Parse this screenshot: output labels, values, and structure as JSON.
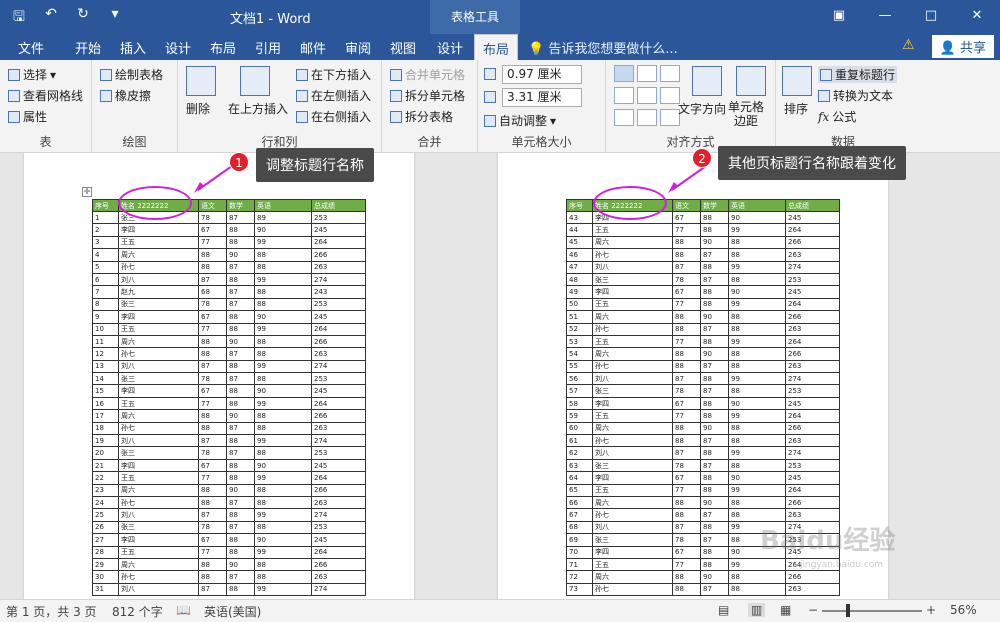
{
  "window": {
    "title": "文档1 - Word",
    "context_tab": "表格工具",
    "quick_access": [
      "save-icon",
      "undo-icon",
      "redo-icon",
      "customize-icon"
    ],
    "window_buttons": [
      "ribbon-display-icon",
      "minimize-icon",
      "maximize-icon",
      "close-icon"
    ]
  },
  "tabs": [
    "文件",
    "开始",
    "插入",
    "设计",
    "布局",
    "引用",
    "邮件",
    "审阅",
    "视图",
    "设计",
    "布局"
  ],
  "active_tab": "布局",
  "tell_me": "告诉我您想要做什么...",
  "share": "共享",
  "ribbon": {
    "table_group": {
      "label": "表",
      "items": [
        "选择",
        "查看网格线",
        "属性"
      ]
    },
    "draw_group": {
      "label": "绘图",
      "items": [
        "绘制表格",
        "橡皮擦"
      ]
    },
    "rowscols_group": {
      "label": "行和列",
      "delete": "删除",
      "insert_above": "在上方插入",
      "items": [
        "在下方插入",
        "在左侧插入",
        "在右侧插入"
      ]
    },
    "merge_group": {
      "label": "合并",
      "items": [
        "合并单元格",
        "拆分单元格",
        "拆分表格"
      ]
    },
    "cellsize_group": {
      "label": "单元格大小",
      "height": "0.97 厘米",
      "width": "3.31 厘米",
      "autofit": "自动调整"
    },
    "align_group": {
      "label": "对齐方式",
      "text_direction": "文字方向",
      "cell_margins": "单元格\n边距"
    },
    "data_group": {
      "label": "数据",
      "sort": "排序",
      "items": [
        "重复标题行",
        "转换为文本",
        "公式"
      ]
    }
  },
  "table_header": [
    "序号",
    "姓名 2222222",
    "语文",
    "数学",
    "英语",
    "总成绩"
  ],
  "page1_rows": [
    [
      "1",
      "张三",
      "78",
      "87",
      "89",
      "253"
    ],
    [
      "2",
      "李四",
      "67",
      "88",
      "90",
      "245"
    ],
    [
      "3",
      "王五",
      "77",
      "88",
      "99",
      "264"
    ],
    [
      "4",
      "周六",
      "88",
      "90",
      "88",
      "266"
    ],
    [
      "5",
      "孙七",
      "88",
      "87",
      "88",
      "263"
    ],
    [
      "6",
      "刘八",
      "87",
      "88",
      "99",
      "274"
    ],
    [
      "7",
      "赵九",
      "68",
      "87",
      "88",
      "243"
    ],
    [
      "8",
      "张三",
      "78",
      "87",
      "88",
      "253"
    ],
    [
      "9",
      "李四",
      "67",
      "88",
      "90",
      "245"
    ],
    [
      "10",
      "王五",
      "77",
      "88",
      "99",
      "264"
    ],
    [
      "11",
      "周六",
      "88",
      "90",
      "88",
      "266"
    ],
    [
      "12",
      "孙七",
      "88",
      "87",
      "88",
      "263"
    ],
    [
      "13",
      "刘八",
      "87",
      "88",
      "99",
      "274"
    ],
    [
      "14",
      "张三",
      "78",
      "87",
      "88",
      "253"
    ],
    [
      "15",
      "李四",
      "67",
      "88",
      "90",
      "245"
    ],
    [
      "16",
      "王五",
      "77",
      "88",
      "99",
      "264"
    ],
    [
      "17",
      "周六",
      "88",
      "90",
      "88",
      "266"
    ],
    [
      "18",
      "孙七",
      "88",
      "87",
      "88",
      "263"
    ],
    [
      "19",
      "刘八",
      "87",
      "88",
      "99",
      "274"
    ],
    [
      "20",
      "张三",
      "78",
      "87",
      "88",
      "253"
    ],
    [
      "21",
      "李四",
      "67",
      "88",
      "90",
      "245"
    ],
    [
      "22",
      "王五",
      "77",
      "88",
      "99",
      "264"
    ],
    [
      "23",
      "周六",
      "88",
      "90",
      "88",
      "266"
    ],
    [
      "24",
      "孙七",
      "88",
      "87",
      "88",
      "263"
    ],
    [
      "25",
      "刘八",
      "87",
      "88",
      "99",
      "274"
    ],
    [
      "26",
      "张三",
      "78",
      "87",
      "88",
      "253"
    ],
    [
      "27",
      "李四",
      "67",
      "88",
      "90",
      "245"
    ],
    [
      "28",
      "王五",
      "77",
      "88",
      "99",
      "264"
    ],
    [
      "29",
      "周六",
      "88",
      "90",
      "88",
      "266"
    ],
    [
      "30",
      "孙七",
      "88",
      "87",
      "88",
      "263"
    ],
    [
      "31",
      "刘八",
      "87",
      "88",
      "99",
      "274"
    ]
  ],
  "page2_rows": [
    [
      "43",
      "李四",
      "67",
      "88",
      "90",
      "245"
    ],
    [
      "44",
      "王五",
      "77",
      "88",
      "99",
      "264"
    ],
    [
      "45",
      "周六",
      "88",
      "90",
      "88",
      "266"
    ],
    [
      "46",
      "孙七",
      "88",
      "87",
      "88",
      "263"
    ],
    [
      "47",
      "刘八",
      "87",
      "88",
      "99",
      "274"
    ],
    [
      "48",
      "张三",
      "78",
      "87",
      "88",
      "253"
    ],
    [
      "49",
      "李四",
      "67",
      "88",
      "90",
      "245"
    ],
    [
      "50",
      "王五",
      "77",
      "88",
      "99",
      "264"
    ],
    [
      "51",
      "周六",
      "88",
      "90",
      "88",
      "266"
    ],
    [
      "52",
      "孙七",
      "88",
      "87",
      "88",
      "263"
    ],
    [
      "53",
      "王五",
      "77",
      "88",
      "99",
      "264"
    ],
    [
      "54",
      "周六",
      "88",
      "90",
      "88",
      "266"
    ],
    [
      "55",
      "孙七",
      "88",
      "87",
      "88",
      "263"
    ],
    [
      "56",
      "刘八",
      "87",
      "88",
      "99",
      "274"
    ],
    [
      "57",
      "张三",
      "78",
      "87",
      "88",
      "253"
    ],
    [
      "58",
      "李四",
      "67",
      "88",
      "90",
      "245"
    ],
    [
      "59",
      "王五",
      "77",
      "88",
      "99",
      "264"
    ],
    [
      "60",
      "周六",
      "88",
      "90",
      "88",
      "266"
    ],
    [
      "61",
      "孙七",
      "88",
      "87",
      "88",
      "263"
    ],
    [
      "62",
      "刘八",
      "87",
      "88",
      "99",
      "274"
    ],
    [
      "63",
      "张三",
      "78",
      "87",
      "88",
      "253"
    ],
    [
      "64",
      "李四",
      "67",
      "88",
      "90",
      "245"
    ],
    [
      "65",
      "王五",
      "77",
      "88",
      "99",
      "264"
    ],
    [
      "66",
      "周六",
      "88",
      "90",
      "88",
      "266"
    ],
    [
      "67",
      "孙七",
      "88",
      "87",
      "88",
      "263"
    ],
    [
      "68",
      "刘八",
      "87",
      "88",
      "99",
      "274"
    ],
    [
      "69",
      "张三",
      "78",
      "87",
      "88",
      "253"
    ],
    [
      "70",
      "李四",
      "67",
      "88",
      "90",
      "245"
    ],
    [
      "71",
      "王五",
      "77",
      "88",
      "99",
      "264"
    ],
    [
      "72",
      "周六",
      "88",
      "90",
      "88",
      "266"
    ],
    [
      "73",
      "孙七",
      "88",
      "87",
      "88",
      "263"
    ]
  ],
  "callouts": [
    {
      "num": "1",
      "text": "调整标题行名称"
    },
    {
      "num": "2",
      "text": "其他页标题行名称跟着变化"
    }
  ],
  "status": {
    "page": "第 1 页，共 3 页",
    "words": "812 个字",
    "lang": "英语(美国)",
    "zoom": "56%"
  },
  "watermark": {
    "brand": "Baidu经验",
    "url": "jingyan.baidu.com"
  }
}
